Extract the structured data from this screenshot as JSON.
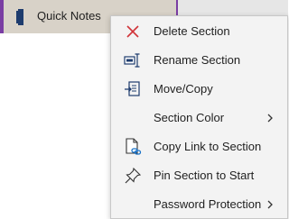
{
  "tab": {
    "label": "Quick Notes",
    "color": "#7a3ea3"
  },
  "menu": {
    "items": [
      {
        "label": "Delete Section",
        "icon": "close-icon"
      },
      {
        "label": "Rename Section",
        "icon": "rename-icon"
      },
      {
        "label": "Move/Copy",
        "icon": "move-copy-icon"
      },
      {
        "label": "Section Color",
        "icon": "",
        "submenu": true
      },
      {
        "label": "Copy Link to Section",
        "icon": "copy-link-icon"
      },
      {
        "label": "Pin Section to Start",
        "icon": "pin-icon"
      },
      {
        "label": "Password Protection",
        "icon": "",
        "submenu": true
      }
    ]
  }
}
